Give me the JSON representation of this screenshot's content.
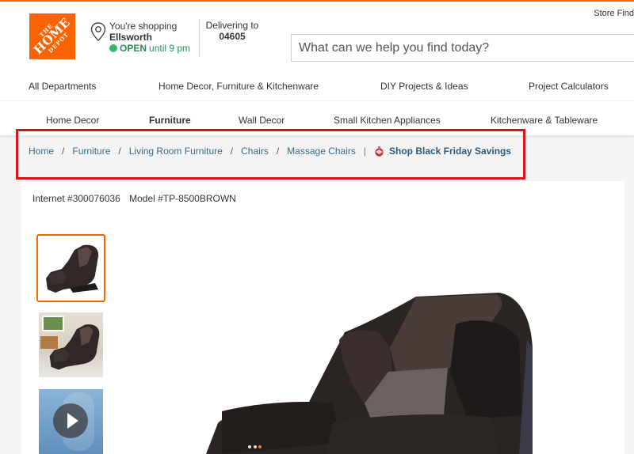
{
  "header": {
    "store_finder": "Store Find",
    "logo": {
      "line1": "THE",
      "line2": "HOME",
      "line3": "DEPOT",
      "brand_color": "#f96302"
    },
    "store": {
      "shopping_label": "You're shopping",
      "city": "Ellsworth",
      "status": "OPEN",
      "hours": "until 9 pm",
      "status_color": "#3cb371"
    },
    "delivery": {
      "label": "Delivering to",
      "zip": "04605"
    },
    "search": {
      "placeholder": "What can we help you find today?",
      "value": ""
    }
  },
  "nav_primary": [
    {
      "label": "All Departments"
    },
    {
      "label": "Home Decor, Furniture & Kitchenware"
    },
    {
      "label": "DIY Projects & Ideas"
    },
    {
      "label": "Project Calculators"
    }
  ],
  "nav_secondary": [
    {
      "label": "Home Decor",
      "active": false
    },
    {
      "label": "Furniture",
      "active": true
    },
    {
      "label": "Wall Decor",
      "active": false
    },
    {
      "label": "Small Kitchen Appliances",
      "active": false
    },
    {
      "label": "Kitchenware & Tableware",
      "active": false
    }
  ],
  "breadcrumb": {
    "items": [
      {
        "label": "Home"
      },
      {
        "label": "Furniture"
      },
      {
        "label": "Living Room Furniture"
      },
      {
        "label": "Chairs"
      },
      {
        "label": "Massage Chairs"
      }
    ],
    "separator": "/",
    "pipe": "|",
    "promo": {
      "icon": "ornament-icon",
      "label": "Shop Black Friday Savings"
    },
    "highlight_color": "#d9141b"
  },
  "product": {
    "internet_number": "Internet #300076036",
    "model_number": "Model #TP-8500BROWN",
    "thumbnails": [
      {
        "type": "image",
        "alt": "massage chair front view",
        "selected": true
      },
      {
        "type": "image",
        "alt": "massage chair in living room",
        "selected": false
      },
      {
        "type": "video",
        "alt": "massage chair video",
        "selected": false
      }
    ],
    "main_image_alt": "brown massage chair close-up"
  }
}
